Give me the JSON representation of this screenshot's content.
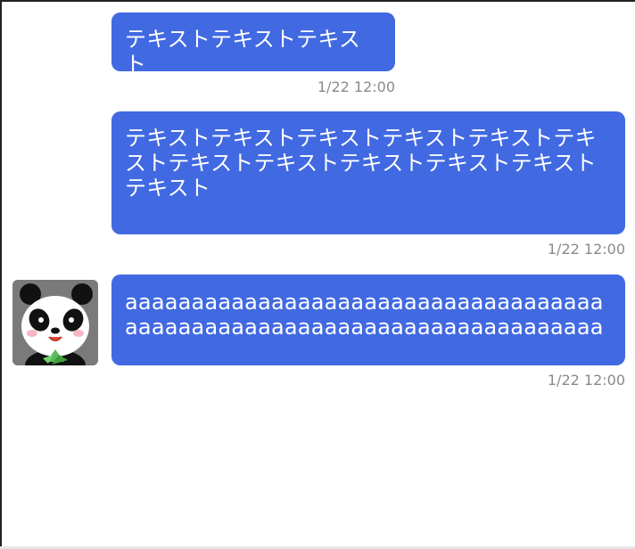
{
  "chat": {
    "messages": [
      {
        "text": "テキストテキストテキスト",
        "time": "1/22 12:00"
      },
      {
        "text": "テキストテキストテキストテキストテキストテキストテキストテキストテキストテキストテキストテキスト",
        "time": "1/22 12:00"
      },
      {
        "text": "aaaaaaaaaaaaaaaaaaaaaaaaaaaaaaaaaaaaaaaaaaaaaaaaaaaaaaaaaaaaaaaaaaaaaaaa",
        "time": "1/22 12:00",
        "avatar": "panda-avatar-icon"
      }
    ]
  },
  "colors": {
    "bubble": "#4169e1",
    "timestamp": "#8a8a8a",
    "avatar_bg": "#7a7a7a"
  }
}
